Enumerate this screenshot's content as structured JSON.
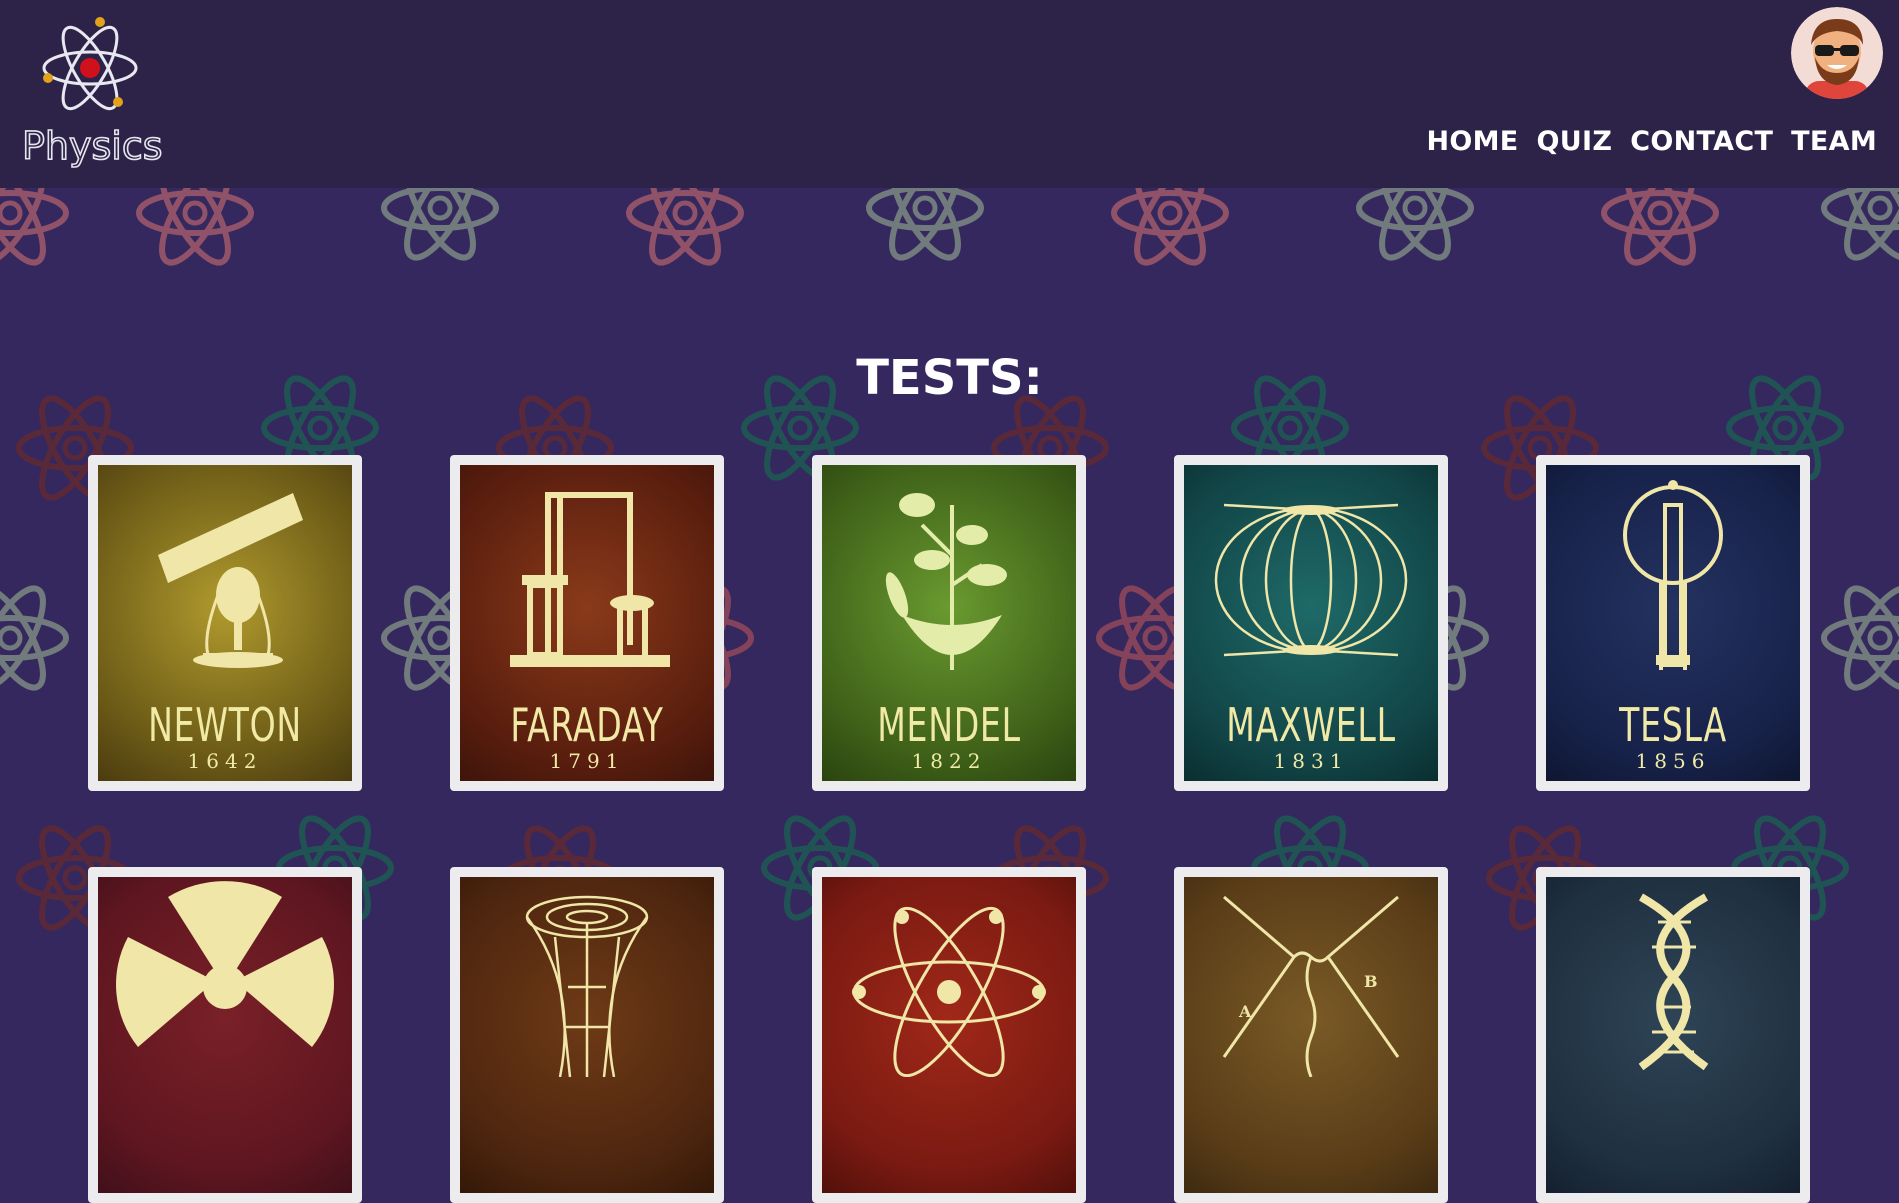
{
  "brand": {
    "logo_text": "Physics"
  },
  "nav": {
    "home": "HOME",
    "quiz": "QUIZ",
    "contact": "CONTACT",
    "team": "TEAM"
  },
  "main": {
    "title": "TESTS:"
  },
  "colors": {
    "header": "#2d2348",
    "background": "#35285e",
    "card_frame": "#ececef",
    "poster_text": "#f1eaa6"
  },
  "cards_row1": [
    {
      "name": "NEWTON",
      "year": "1642",
      "icon": "telescope-icon",
      "bg": "#7a6a1c"
    },
    {
      "name": "FARADAY",
      "year": "1791",
      "icon": "apparatus-icon",
      "bg": "#6b2714"
    },
    {
      "name": "MENDEL",
      "year": "1822",
      "icon": "plant-icon",
      "bg": "#4a6a22"
    },
    {
      "name": "MAXWELL",
      "year": "1831",
      "icon": "field-lines-icon",
      "bg": "#124547"
    },
    {
      "name": "TESLA",
      "year": "1856",
      "icon": "lightbulb-icon",
      "bg": "#17224a"
    }
  ],
  "cards_row2": [
    {
      "icon": "radiation-icon",
      "bg": "#5e1620"
    },
    {
      "icon": "wormhole-icon",
      "bg": "#4e260f"
    },
    {
      "icon": "atom-icon",
      "bg": "#7a1a12"
    },
    {
      "icon": "feynman-diagram-icon",
      "bg": "#5a3d18"
    },
    {
      "icon": "dna-icon",
      "bg": "#1f3040"
    }
  ]
}
